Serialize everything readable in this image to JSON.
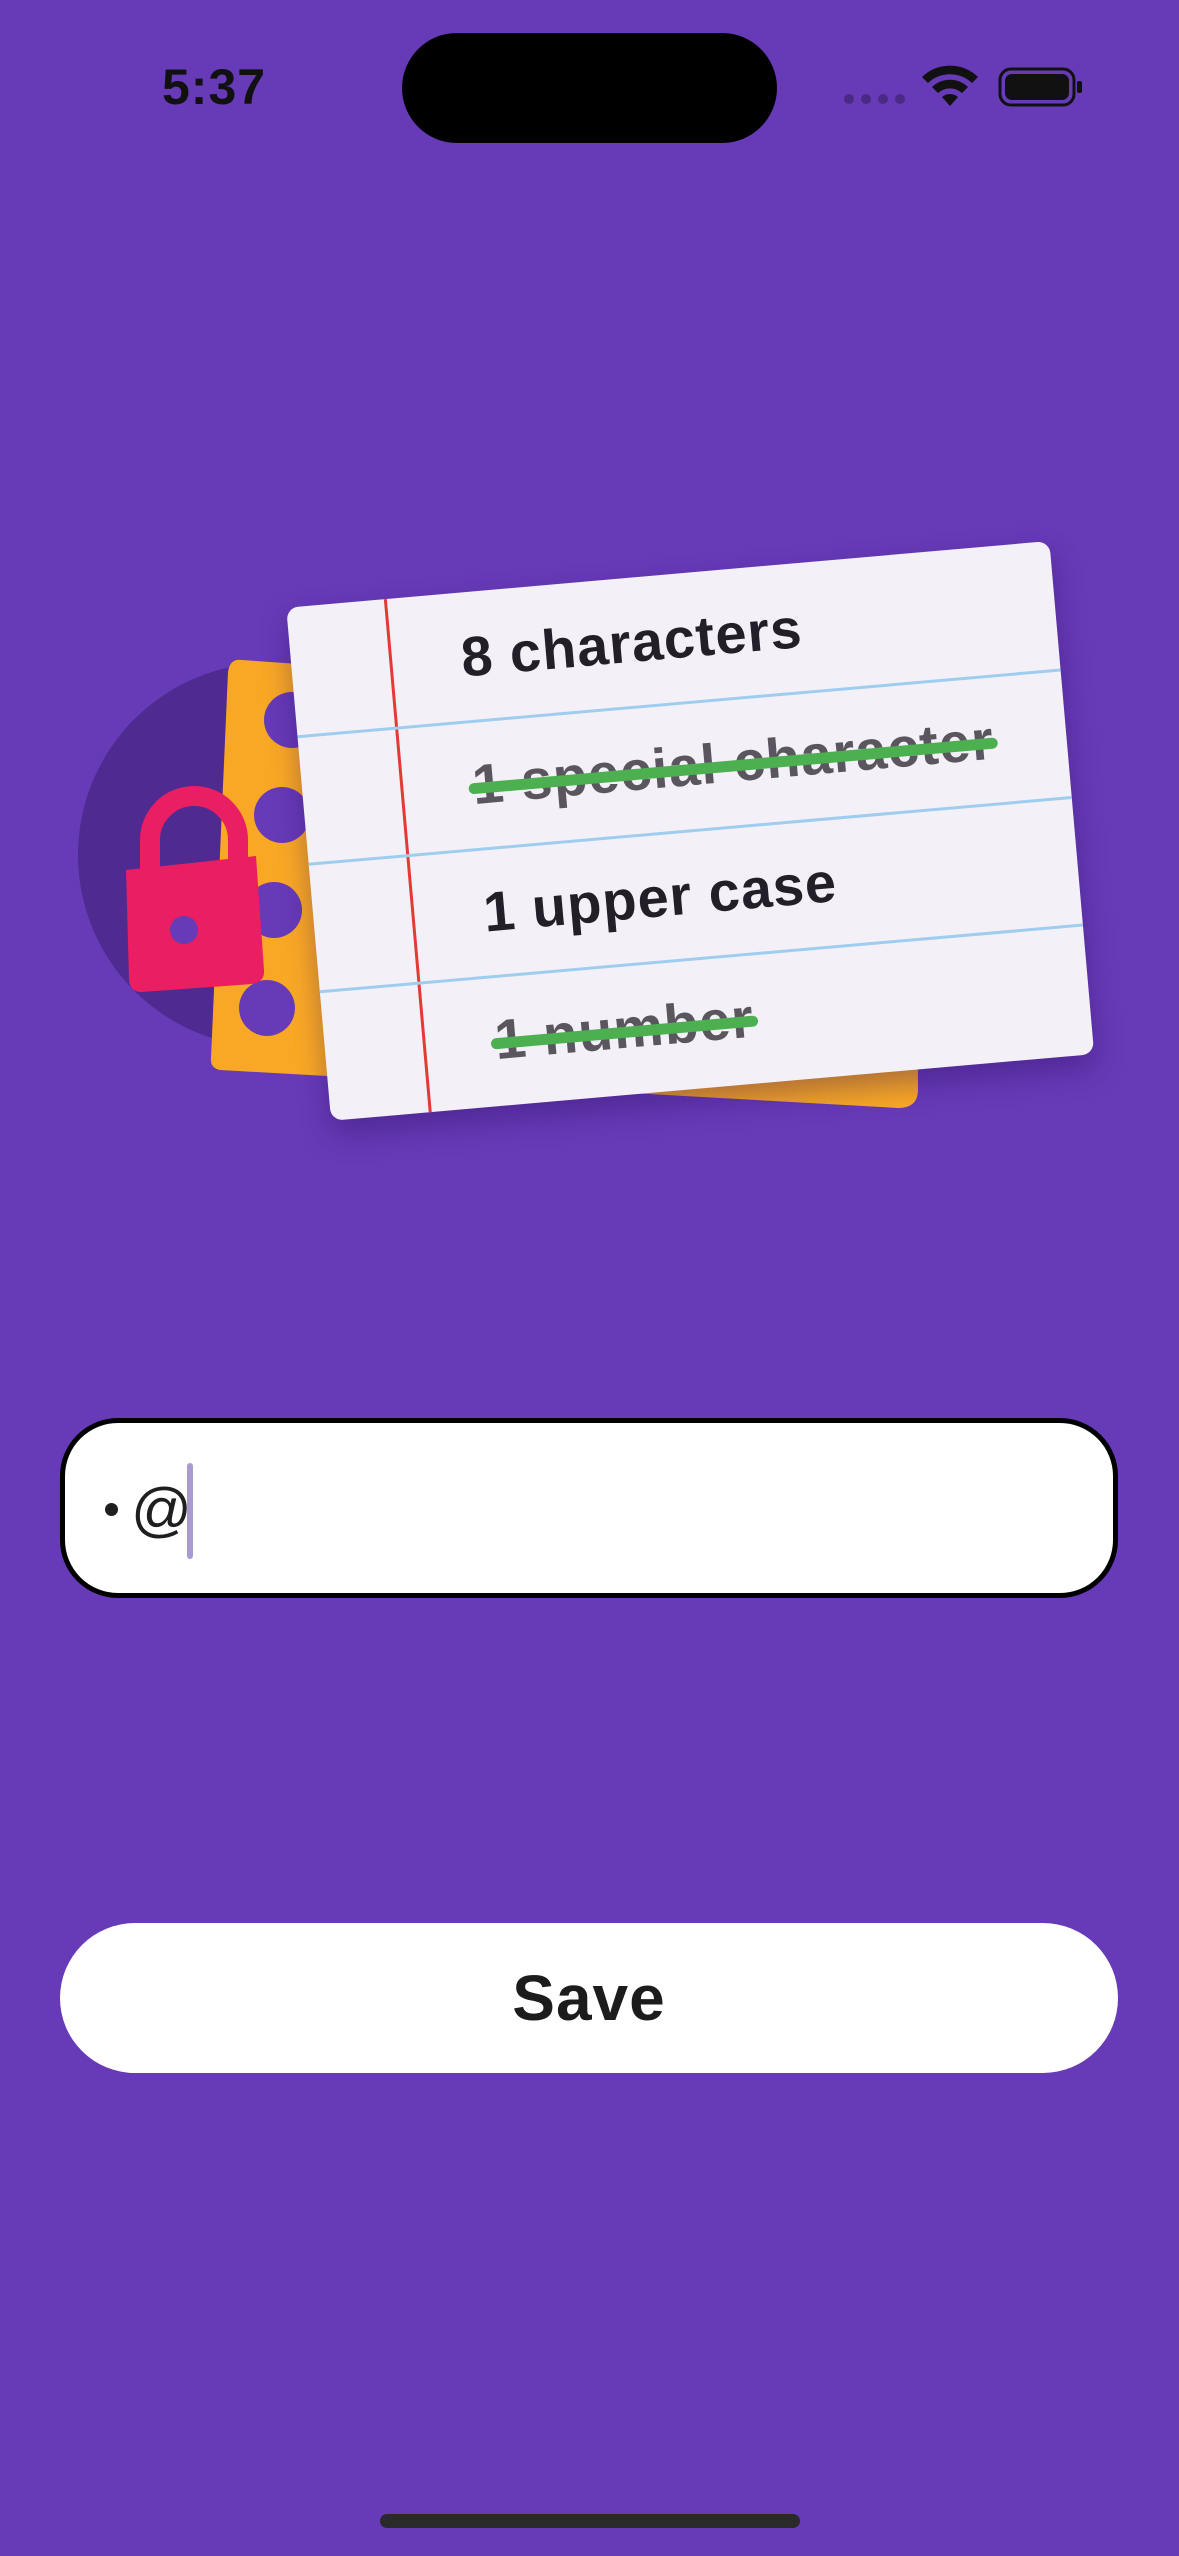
{
  "status_bar": {
    "time": "5:37",
    "icons": [
      "cellular-signal-icon",
      "wifi-icon",
      "battery-icon"
    ]
  },
  "illustration": {
    "icons": [
      "lock-icon",
      "password-dots-card",
      "notepad-card"
    ],
    "colors": {
      "circle": "#4e2a91",
      "lock": "#e91e63",
      "dots_card": "#f9a825",
      "note_paper": "#f4f0f7",
      "strike": "#4caf50"
    }
  },
  "requirements": [
    {
      "text": "8 characters",
      "met": false
    },
    {
      "text": "1 special character",
      "met": true
    },
    {
      "text": "1 upper case",
      "met": false
    },
    {
      "text": "1 number",
      "met": true
    }
  ],
  "password_input": {
    "masked_prefix": "•",
    "visible_char": "@"
  },
  "save_button": {
    "label": "Save"
  },
  "colors": {
    "background": "#673ab7",
    "button_bg": "#ffffff",
    "input_border": "#000000",
    "caret": "#a99bd0"
  }
}
